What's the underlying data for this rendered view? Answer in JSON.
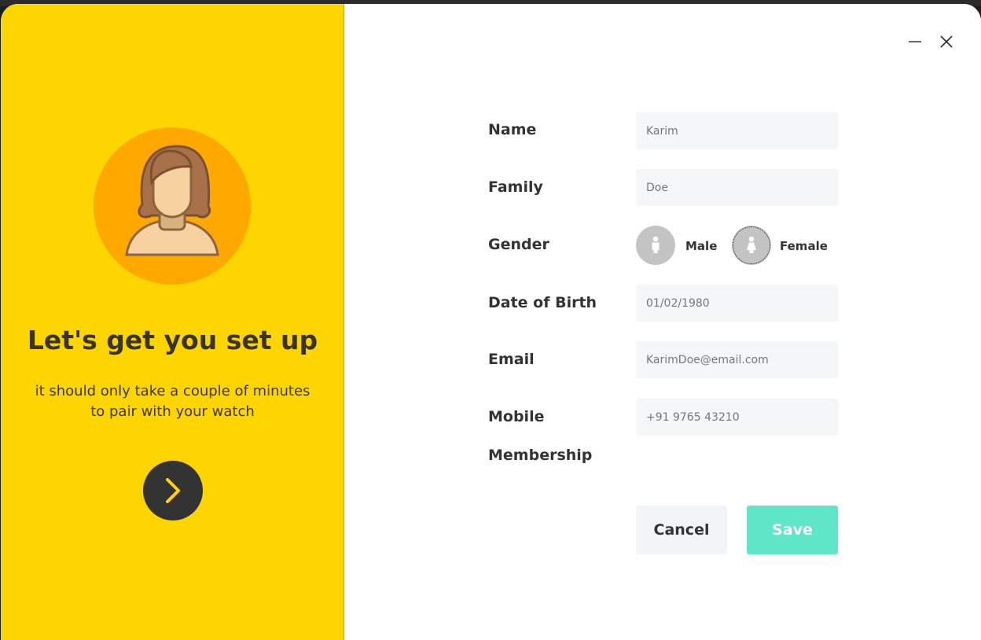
{
  "colors": {
    "accent_yellow": "#ffd500",
    "avatar_bg": "#ffa800",
    "save_button": "#5fe5c8"
  },
  "hero": {
    "title": "Let's get you set up",
    "subtitle_line1": "it should only take a couple of minutes",
    "subtitle_line2": "to pair with your watch",
    "avatar_icon": "woman-avatar-icon",
    "next_icon": "chevron-right-icon"
  },
  "window_controls": {
    "minimize_icon": "minimize-icon",
    "close_icon": "close-icon"
  },
  "form": {
    "name": {
      "label": "Name",
      "value": "Karim"
    },
    "family": {
      "label": "Family",
      "value": "Doe"
    },
    "gender": {
      "label": "Gender",
      "male": "Male",
      "female": "Female"
    },
    "dob": {
      "label": "Date of Birth",
      "value": "01/02/1980"
    },
    "email": {
      "label": "Email",
      "value": "KarimDoe@email.com"
    },
    "mobile": {
      "label": "Mobile",
      "value": "+91 9765 43210"
    },
    "membership": {
      "label": "Membership"
    }
  },
  "actions": {
    "cancel": "Cancel",
    "save": "Save"
  }
}
